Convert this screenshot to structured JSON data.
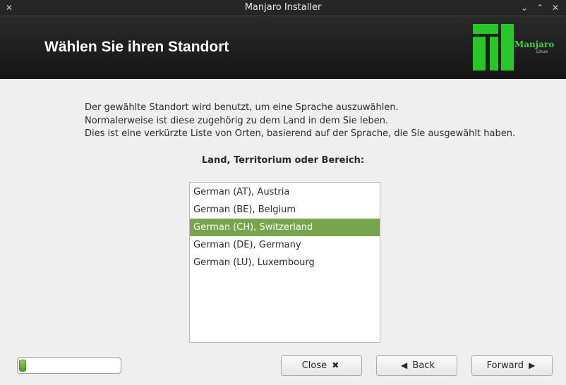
{
  "window": {
    "title": "Manjaro Installer",
    "left_icon": "close-icon",
    "controls": [
      "chevron-down-icon",
      "chevron-up-icon",
      "close-icon"
    ],
    "control_glyphs": [
      "⌄",
      "⌃",
      "✕"
    ],
    "left_glyph": "✕"
  },
  "header": {
    "heading": "Wählen Sie ihren Standort",
    "logo_word": "Manjaro",
    "logo_sub": "Linux",
    "logo_color": "#28c728"
  },
  "main": {
    "description": [
      "Der gewählte Standort wird benutzt, um eine Sprache auszuwählen.",
      "Normalerweise ist diese zugehörig zu dem Land in dem Sie leben.",
      "Dies ist eine verkürzte Liste von Orten, basierend auf der Sprache, die Sie ausgewählt haben."
    ],
    "section_label": "Land, Territorium oder Bereich:",
    "locations": [
      "German (AT), Austria",
      "German (BE), Belgium",
      "German (CH), Switzerland",
      "German (DE), Germany",
      "German (LU), Luxembourg"
    ],
    "selected_index": 2,
    "selected_color": "#76a54b"
  },
  "footer": {
    "progress_fraction": 0.05,
    "close_label": "Close",
    "close_icon": "close-icon",
    "close_glyph": "✖",
    "back_label": "Back",
    "back_icon": "arrow-left-icon",
    "back_glyph": "◀",
    "forward_label": "Forward",
    "forward_icon": "arrow-right-icon",
    "forward_glyph": "▶"
  }
}
